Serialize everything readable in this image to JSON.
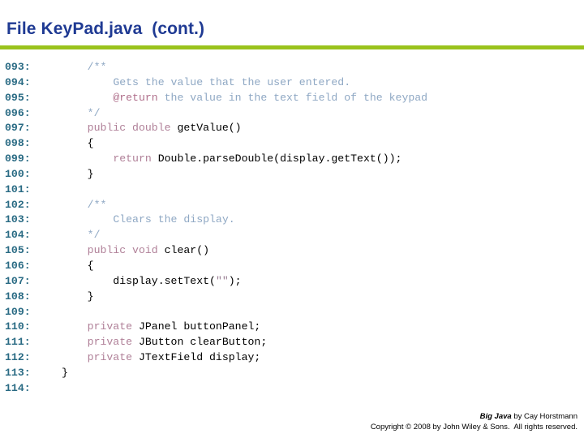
{
  "slide": {
    "title": "File KeyPad.java  (cont.)",
    "accent_color": "#9ac31c",
    "title_color": "#1f3a93",
    "lineno_color": "#2a6b84",
    "comment_color": "#8fa8c4",
    "keyword_color": "#b08098"
  },
  "code": {
    "lines": [
      {
        "n": "093:",
        "tokens": [
          {
            "t": "    ",
            "c": "plain"
          },
          {
            "t": "/**",
            "c": "comment"
          }
        ]
      },
      {
        "n": "094:",
        "tokens": [
          {
            "t": "        ",
            "c": "plain"
          },
          {
            "t": "Gets the value that the user entered.",
            "c": "comment"
          }
        ]
      },
      {
        "n": "095:",
        "tokens": [
          {
            "t": "        ",
            "c": "plain"
          },
          {
            "t": "@return",
            "c": "tag"
          },
          {
            "t": " the value in the text field of the keypad",
            "c": "comment"
          }
        ]
      },
      {
        "n": "096:",
        "tokens": [
          {
            "t": "    ",
            "c": "plain"
          },
          {
            "t": "*/",
            "c": "comment"
          }
        ]
      },
      {
        "n": "097:",
        "tokens": [
          {
            "t": "    ",
            "c": "plain"
          },
          {
            "t": "public double ",
            "c": "keyword"
          },
          {
            "t": "getValue()",
            "c": "plain"
          }
        ]
      },
      {
        "n": "098:",
        "tokens": [
          {
            "t": "    {",
            "c": "plain"
          }
        ]
      },
      {
        "n": "099:",
        "tokens": [
          {
            "t": "        ",
            "c": "plain"
          },
          {
            "t": "return ",
            "c": "keyword"
          },
          {
            "t": "Double.parseDouble(display.getText());",
            "c": "plain"
          }
        ]
      },
      {
        "n": "100:",
        "tokens": [
          {
            "t": "    }",
            "c": "plain"
          }
        ]
      },
      {
        "n": "101:",
        "tokens": [
          {
            "t": "",
            "c": "plain"
          }
        ]
      },
      {
        "n": "102:",
        "tokens": [
          {
            "t": "    ",
            "c": "plain"
          },
          {
            "t": "/**",
            "c": "comment"
          }
        ]
      },
      {
        "n": "103:",
        "tokens": [
          {
            "t": "        ",
            "c": "plain"
          },
          {
            "t": "Clears the display.",
            "c": "comment"
          }
        ]
      },
      {
        "n": "104:",
        "tokens": [
          {
            "t": "    ",
            "c": "plain"
          },
          {
            "t": "*/",
            "c": "comment"
          }
        ]
      },
      {
        "n": "105:",
        "tokens": [
          {
            "t": "    ",
            "c": "plain"
          },
          {
            "t": "public void ",
            "c": "keyword"
          },
          {
            "t": "clear()",
            "c": "plain"
          }
        ]
      },
      {
        "n": "106:",
        "tokens": [
          {
            "t": "    {",
            "c": "plain"
          }
        ]
      },
      {
        "n": "107:",
        "tokens": [
          {
            "t": "        display.setText(",
            "c": "plain"
          },
          {
            "t": "\"\"",
            "c": "string"
          },
          {
            "t": ");",
            "c": "plain"
          }
        ]
      },
      {
        "n": "108:",
        "tokens": [
          {
            "t": "    }",
            "c": "plain"
          }
        ]
      },
      {
        "n": "109:",
        "tokens": [
          {
            "t": "",
            "c": "plain"
          }
        ]
      },
      {
        "n": "110:",
        "tokens": [
          {
            "t": "    ",
            "c": "plain"
          },
          {
            "t": "private ",
            "c": "keyword"
          },
          {
            "t": "JPanel buttonPanel;",
            "c": "plain"
          }
        ]
      },
      {
        "n": "111:",
        "tokens": [
          {
            "t": "    ",
            "c": "plain"
          },
          {
            "t": "private ",
            "c": "keyword"
          },
          {
            "t": "JButton clearButton;",
            "c": "plain"
          }
        ]
      },
      {
        "n": "112:",
        "tokens": [
          {
            "t": "    ",
            "c": "plain"
          },
          {
            "t": "private ",
            "c": "keyword"
          },
          {
            "t": "JTextField display;",
            "c": "plain"
          }
        ]
      },
      {
        "n": "113:",
        "tokens": [
          {
            "t": "}",
            "c": "plain"
          }
        ]
      },
      {
        "n": "114:",
        "tokens": [
          {
            "t": "",
            "c": "plain"
          }
        ]
      }
    ]
  },
  "footer": {
    "credit_italic": "Big Java",
    "credit_rest": " by Cay Horstmann",
    "copyright": "Copyright © 2008 by John Wiley & Sons.  All rights reserved."
  }
}
